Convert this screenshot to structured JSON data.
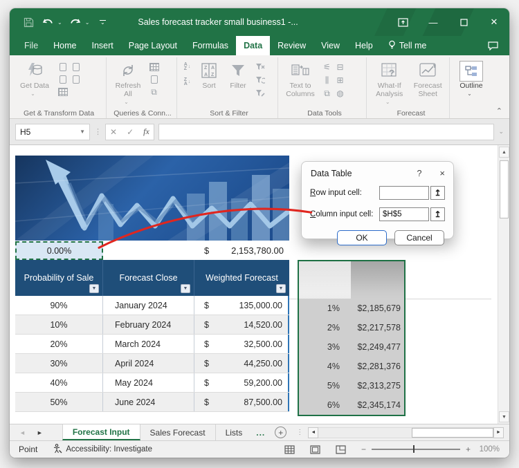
{
  "window": {
    "title": "Sales forecast tracker small business1  -..."
  },
  "ribbon": {
    "tabs": {
      "file": "File",
      "home": "Home",
      "insert": "Insert",
      "page_layout": "Page Layout",
      "formulas": "Formulas",
      "data": "Data",
      "review": "Review",
      "view": "View",
      "help": "Help",
      "tell_me": "Tell me"
    },
    "groups": {
      "get_transform": {
        "button": "Get Data",
        "label": "Get & Transform Data"
      },
      "queries": {
        "button": "Refresh All",
        "label": "Queries & Conn..."
      },
      "sort_filter": {
        "sort": "Sort",
        "filter": "Filter",
        "label": "Sort & Filter"
      },
      "data_tools": {
        "button": "Text to Columns",
        "label": "Data Tools"
      },
      "forecast": {
        "what_if": "What-If Analysis",
        "sheet": "Forecast Sheet",
        "label": "Forecast"
      },
      "outline": {
        "button": "Outline"
      }
    }
  },
  "formula_bar": {
    "name_box": "H5",
    "fx": "fx",
    "value": ""
  },
  "dialog": {
    "title": "Data Table",
    "help": "?",
    "close": "×",
    "row_accel": "R",
    "row_rest": "ow input cell:",
    "row_value": "",
    "col_accel": "C",
    "col_rest": "olumn input cell:",
    "col_value": "$H$5",
    "ok": "OK",
    "cancel": "Cancel"
  },
  "sheet": {
    "scenario_cell": "0.00%",
    "total_currency": "$",
    "total_amount": "2,153,780.00",
    "table": {
      "headers": [
        "Probability of Sale",
        "Forecast Close",
        "Weighted Forecast"
      ],
      "rows": [
        {
          "probability": "90%",
          "month": "January 2024",
          "currency": "$",
          "amount": "135,000.00"
        },
        {
          "probability": "10%",
          "month": "February 2024",
          "currency": "$",
          "amount": "14,520.00"
        },
        {
          "probability": "20%",
          "month": "March 2024",
          "currency": "$",
          "amount": "32,500.00"
        },
        {
          "probability": "30%",
          "month": "April 2024",
          "currency": "$",
          "amount": "44,250.00"
        },
        {
          "probability": "40%",
          "month": "May 2024",
          "currency": "$",
          "amount": "59,200.00"
        },
        {
          "probability": "50%",
          "month": "June 2024",
          "currency": "$",
          "amount": "87,500.00"
        }
      ]
    },
    "what_if_rows": [
      {
        "pct": "1%",
        "value": "$2,185,679"
      },
      {
        "pct": "2%",
        "value": "$2,217,578"
      },
      {
        "pct": "3%",
        "value": "$2,249,477"
      },
      {
        "pct": "4%",
        "value": "$2,281,376"
      },
      {
        "pct": "5%",
        "value": "$2,313,275"
      },
      {
        "pct": "6%",
        "value": "$2,345,174"
      }
    ]
  },
  "tabs_bar": {
    "sheet1": "Forecast Input",
    "sheet2": "Sales Forecast",
    "sheet3": "Lists",
    "more": "..."
  },
  "status_bar": {
    "mode": "Point",
    "accessibility": "Accessibility: Investigate",
    "zoom": "100%"
  },
  "colors": {
    "excel_green": "#217346",
    "header_navy": "#1f4e79",
    "selection_green": "#1e7145",
    "annotation_red": "#e0261f",
    "accent_blue": "#2b6bc9"
  }
}
